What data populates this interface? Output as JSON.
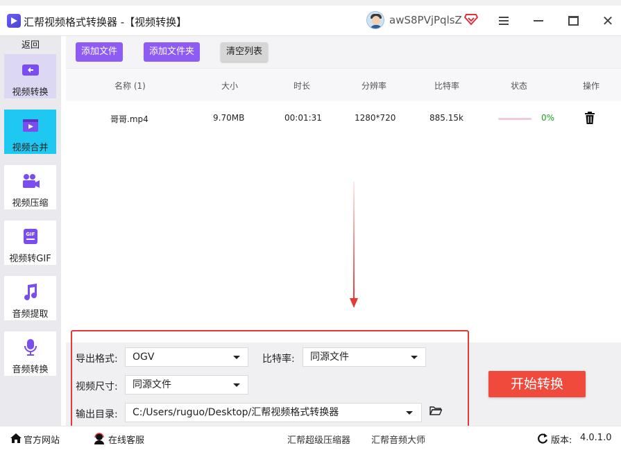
{
  "window": {
    "title": "汇帮视频格式转换器 -【视频转换】",
    "username": "awS8PVjPqlsZ"
  },
  "sidebar": {
    "back_label": "返回",
    "items": [
      {
        "label": "视频转换",
        "icon": "video-convert-icon"
      },
      {
        "label": "视频合并",
        "icon": "video-merge-icon"
      },
      {
        "label": "视频压缩",
        "icon": "video-camera-icon"
      },
      {
        "label": "视频转GIF",
        "icon": "gif-icon"
      },
      {
        "label": "音频提取",
        "icon": "music-note-icon"
      },
      {
        "label": "音频转换",
        "icon": "microphone-icon"
      }
    ]
  },
  "toolbar": {
    "add_file": "添加文件",
    "add_folder": "添加文件夹",
    "clear_list": "清空列表"
  },
  "table": {
    "headers": [
      "名称 (1)",
      "大小",
      "时长",
      "分辨率",
      "比特率",
      "状态",
      "操作"
    ],
    "rows": [
      {
        "name": "哥哥.mp4",
        "size": "9.70MB",
        "duration": "00:01:31",
        "resolution": "1280*720",
        "bitrate": "885.15k",
        "status_pct": "0%",
        "progress": 0
      }
    ]
  },
  "settings": {
    "format_label": "导出格式:",
    "format_value": "OGV",
    "bitrate_label": "比特率:",
    "bitrate_value": "同源文件",
    "size_label": "视频尺寸:",
    "size_value": "同源文件",
    "output_label": "输出目录:",
    "output_value": "C:/Users/ruguo/Desktop/汇帮视频格式转换器"
  },
  "start_button": "开始转换",
  "footer": {
    "official_site": "官方网站",
    "online_service": "在线客服",
    "link1": "汇帮超级压缩器",
    "link2": "汇帮音频大师",
    "version_label": "版本:",
    "version_value": "4.0.1.0"
  },
  "colors": {
    "accent_purple": "#8e5cf5",
    "start_red": "#f04a3c",
    "annotation_red": "#e53935",
    "merge_blue": "#1fc8f0",
    "status_green": "#1aa31a"
  }
}
